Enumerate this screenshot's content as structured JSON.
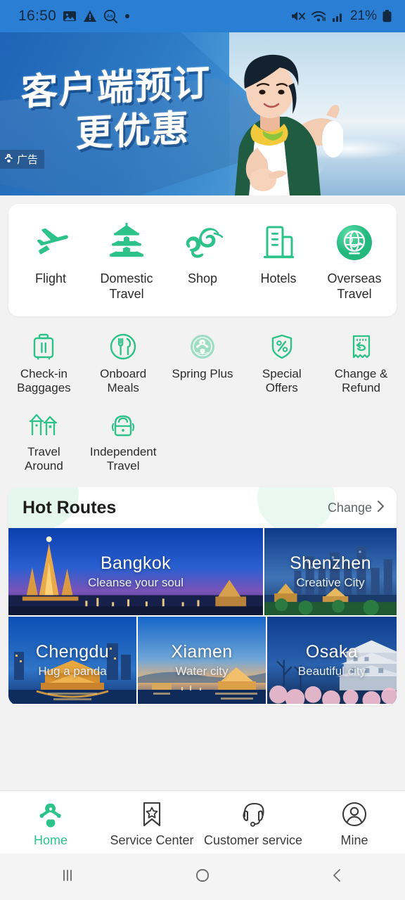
{
  "status_bar": {
    "time": "16:50",
    "battery": "21%",
    "icons": [
      "image-icon",
      "warning-icon",
      "screen-translate-icon",
      "dot-icon",
      "mute-icon",
      "wifi-icon",
      "signal-icon",
      "battery-icon"
    ]
  },
  "banner": {
    "headline_line1": "客户端预订",
    "headline_line2": "更优惠",
    "ad_label": "广告",
    "brand_mark": "spring-airlines-logo"
  },
  "primary_services": [
    {
      "label": "Flight",
      "icon": "airplane-icon"
    },
    {
      "label": "Domestic\nTravel",
      "label_l1": "Domestic",
      "label_l2": "Travel",
      "icon": "pagoda-icon"
    },
    {
      "label": "Shop",
      "icon": "spring-cloud-logo-icon"
    },
    {
      "label": "Hotels",
      "icon": "building-icon"
    },
    {
      "label": "Overseas\nTravel",
      "label_l1": "Overseas",
      "label_l2": "Travel",
      "icon": "globe-circle-icon"
    }
  ],
  "secondary_services": [
    {
      "label_l1": "Check-in",
      "label_l2": "Baggages",
      "icon": "suitcase-icon"
    },
    {
      "label_l1": "Onboard",
      "label_l2": "Meals",
      "icon": "meal-icon"
    },
    {
      "label_l1": "Spring Plus",
      "label_l2": "",
      "icon": "spring-plus-badge-icon"
    },
    {
      "label_l1": "Special",
      "label_l2": "Offers",
      "icon": "discount-shield-icon"
    },
    {
      "label_l1": "Change &",
      "label_l2": "Refund",
      "icon": "refund-receipt-icon"
    },
    {
      "label_l1": "Travel",
      "label_l2": "Around",
      "icon": "temples-icon"
    },
    {
      "label_l1": "Independent",
      "label_l2": "Travel",
      "icon": "backpack-icon"
    }
  ],
  "hot_routes": {
    "title": "Hot Routes",
    "change_label": "Change",
    "chevron": "chevron-right-icon",
    "cards": [
      {
        "name": "Bangkok",
        "subtitle": "Cleanse your soul"
      },
      {
        "name": "Shenzhen",
        "subtitle": "Creative City"
      },
      {
        "name": "Chengdu",
        "subtitle": "Hug a panda"
      },
      {
        "name": "Xiamen",
        "subtitle": "Water city"
      },
      {
        "name": "Osaka",
        "subtitle": "Beautiful city"
      }
    ]
  },
  "tab_bar": [
    {
      "label": "Home",
      "icon": "spring-logo-icon",
      "active": true
    },
    {
      "label": "Service Center",
      "icon": "bookmark-star-icon",
      "active": false
    },
    {
      "label": "Customer service",
      "icon": "headset-icon",
      "active": false
    },
    {
      "label": "Mine",
      "icon": "person-circle-icon",
      "active": false
    }
  ],
  "android_nav": [
    {
      "name": "recents-button",
      "icon": "recents-icon"
    },
    {
      "name": "home-button",
      "icon": "home-circle-icon"
    },
    {
      "name": "back-button",
      "icon": "back-chevron-icon"
    }
  ],
  "colors": {
    "accent_green": "#2ec28b",
    "banner_blue": "#2a7fd4",
    "page_bg": "#f2f2f2",
    "text_dark": "#2b2b2b"
  }
}
